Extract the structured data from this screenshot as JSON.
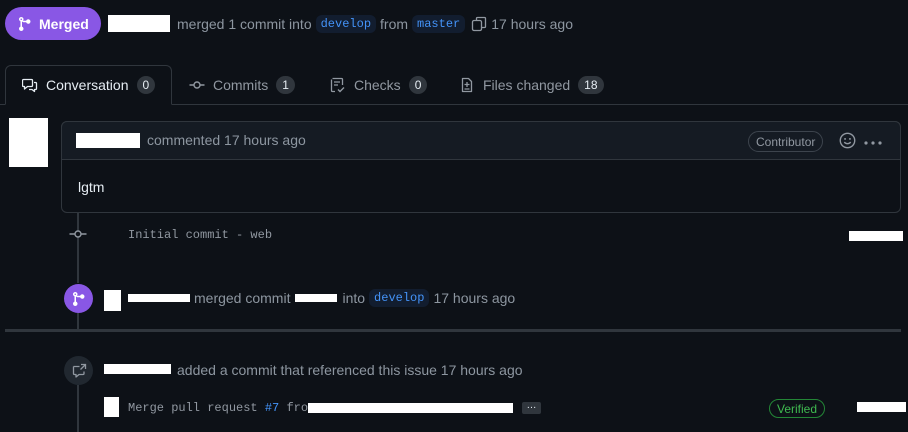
{
  "header": {
    "status_label": "Merged",
    "action_text": "merged 1 commit into",
    "target_branch": "develop",
    "from_text": "from",
    "source_branch": "master",
    "time": "17 hours ago"
  },
  "tabs": [
    {
      "label": "Conversation",
      "count": "0"
    },
    {
      "label": "Commits",
      "count": "1"
    },
    {
      "label": "Checks",
      "count": "0"
    },
    {
      "label": "Files changed",
      "count": "18"
    }
  ],
  "comment": {
    "meta": "commented 17 hours ago",
    "role": "Contributor",
    "body": "lgtm"
  },
  "commit_event": {
    "message": "Initial commit - web"
  },
  "merge_event": {
    "text": "merged commit",
    "into_text": "into",
    "branch": "develop",
    "time": "17 hours ago"
  },
  "reference_event": {
    "text": "added a commit that referenced this issue 17 hours ago",
    "commit_prefix": "Merge pull request",
    "pr_number": "#7",
    "from_text": "from",
    "ellipsis": "…",
    "verified": "Verified"
  },
  "colors": {
    "background": "#0d1117",
    "merged_purple": "#8957e5",
    "link_blue": "#4493f8",
    "verified_green": "#3fb950"
  }
}
